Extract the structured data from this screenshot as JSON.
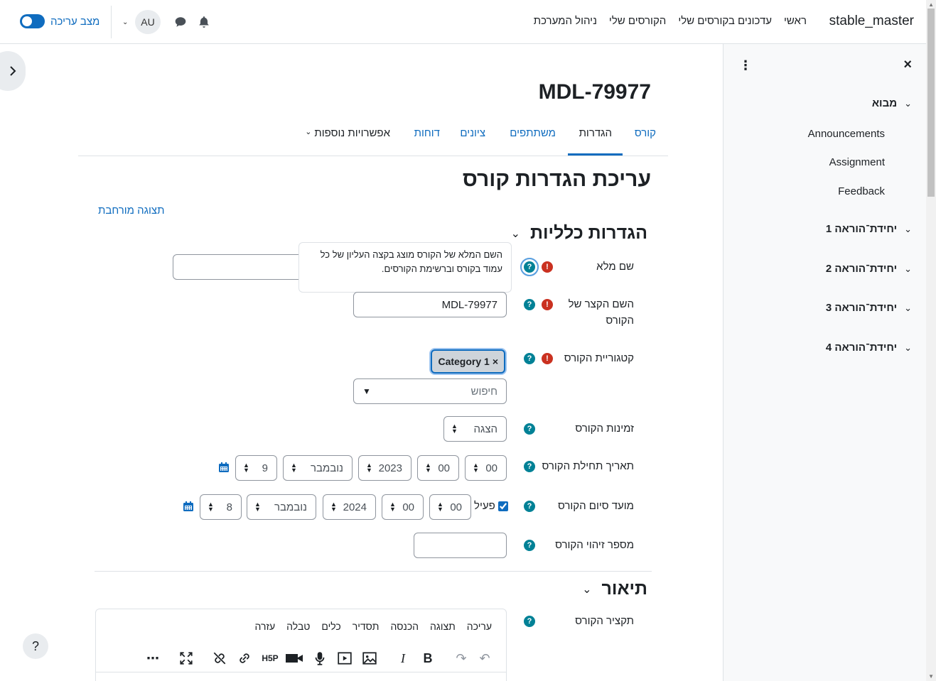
{
  "navbar": {
    "brand": "stable_master",
    "links": [
      "ראשי",
      "עדכונים בקורסים שלי",
      "הקורסים שלי",
      "ניהול המערכת"
    ],
    "avatar_initials": "AU",
    "edit_mode_label": "מצב עריכה",
    "accent": "#0f6cbf"
  },
  "drawer": {
    "close_icon": "×",
    "sections": [
      {
        "label": "מבוא",
        "items": [
          "Announcements",
          "Assignment",
          "Feedback"
        ]
      },
      {
        "label": "יחידת־הוראה 1"
      },
      {
        "label": "יחידת־הוראה 2"
      },
      {
        "label": "יחידת־הוראה 3"
      },
      {
        "label": "יחידת־הוראה 4"
      }
    ]
  },
  "course": {
    "title": "MDL-79977",
    "tabs": [
      "קורס",
      "הגדרות",
      "משתתפים",
      "ציונים",
      "דוחות",
      "אפשרויות נוספות"
    ],
    "active_tab": "הגדרות"
  },
  "page": {
    "heading": "עריכת הגדרות קורס",
    "expand_all": "תצוגה מורחבת"
  },
  "general": {
    "heading": "הגדרות כלליות",
    "fullname_label": "שם מלא",
    "fullname_value": "",
    "tooltip": "השם המלא של הקורס מוצג בקצה העליון של כל עמוד בקורס וברשימת הקורסים.",
    "shortname_label": "השם הקצר של הקורס",
    "shortname_value": "MDL-79977",
    "category_label": "קטגוריית הקורס",
    "category_badge": "Category 1",
    "category_remove": "×",
    "category_search_placeholder": "חיפוש",
    "visibility_label": "זמינות הקורס",
    "visibility_value": "הצגה",
    "start_label": "תאריך תחילת הקורס",
    "start": {
      "day": "9",
      "month": "נובמבר",
      "year": "2023",
      "hour": "00",
      "minute": "00"
    },
    "end_label": "מועד סיום הקורס",
    "end_enabled_label": "פעיל",
    "end_enabled": true,
    "end": {
      "day": "8",
      "month": "נובמבר",
      "year": "2024",
      "hour": "00",
      "minute": "00"
    },
    "idnumber_label": "מספר זיהוי הקורס",
    "idnumber_value": ""
  },
  "description": {
    "heading": "תיאור",
    "summary_label": "תקציר הקורס",
    "menubar": [
      "עריכה",
      "תצוגה",
      "הכנסה",
      "תסדיר",
      "כלים",
      "טבלה",
      "עזרה"
    ]
  },
  "colors": {
    "help": "#008196",
    "required": "#ca3120",
    "link": "#0f6cbf"
  }
}
